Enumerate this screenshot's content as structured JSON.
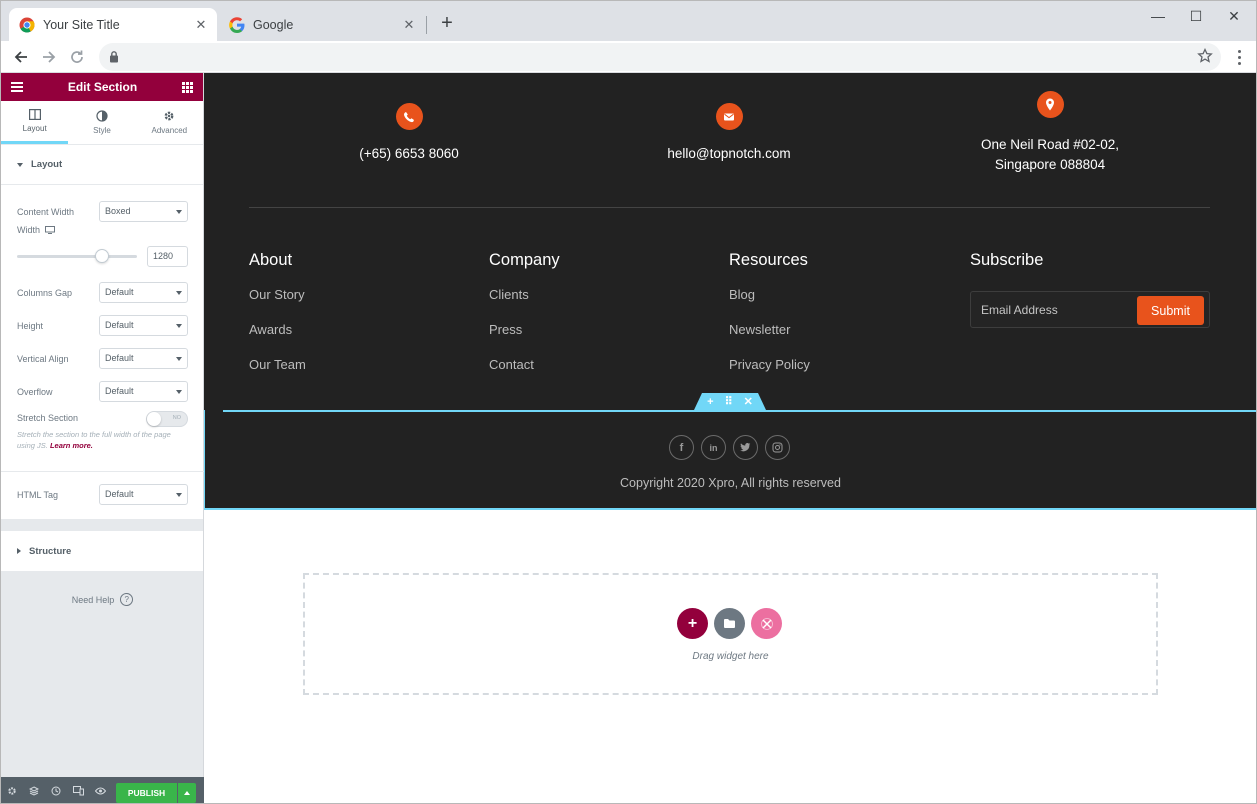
{
  "browser": {
    "tabs": [
      {
        "title": "Your Site Title",
        "icon": "chrome-icon",
        "active": true
      },
      {
        "title": "Google",
        "icon": "google-icon",
        "active": false
      }
    ],
    "new_tab_label": "+",
    "close_glyph": "✕",
    "window_controls": {
      "minimize": "—",
      "maximize": "☐",
      "close": "✕"
    }
  },
  "editor": {
    "header_title": "Edit Section",
    "tabs": [
      {
        "label": "Layout",
        "icon": "columns-icon",
        "active": true
      },
      {
        "label": "Style",
        "icon": "contrast-icon",
        "active": false
      },
      {
        "label": "Advanced",
        "icon": "gear-icon",
        "active": false
      }
    ],
    "layout_section": {
      "title": "Layout",
      "content_width": {
        "label": "Content Width",
        "value": "Boxed"
      },
      "width": {
        "label": "Width",
        "value": "1280"
      },
      "columns_gap": {
        "label": "Columns Gap",
        "value": "Default"
      },
      "height": {
        "label": "Height",
        "value": "Default"
      },
      "vertical_align": {
        "label": "Vertical Align",
        "value": "Default"
      },
      "overflow": {
        "label": "Overflow",
        "value": "Default"
      },
      "stretch_section": {
        "label": "Stretch Section",
        "toggle_text": "NO",
        "enabled": false
      },
      "stretch_desc": "Stretch the section to the full width of the page using JS.",
      "learn_more": "Learn more.",
      "html_tag": {
        "label": "HTML Tag",
        "value": "Default"
      }
    },
    "structure_title": "Structure",
    "need_help": "Need Help",
    "help_glyph": "?",
    "publish_label": "PUBLISH"
  },
  "site": {
    "contacts": [
      {
        "icon": "phone-icon",
        "lines": [
          "(+65) 6653 8060"
        ]
      },
      {
        "icon": "envelope-icon",
        "lines": [
          "hello@topnotch.com"
        ]
      },
      {
        "icon": "location-icon",
        "lines": [
          "One Neil Road #02-02,",
          "Singapore 088804"
        ]
      }
    ],
    "columns": [
      {
        "title": "About",
        "links": [
          "Our Story",
          "Awards",
          "Our Team"
        ]
      },
      {
        "title": "Company",
        "links": [
          "Clients",
          "Press",
          "Contact"
        ]
      },
      {
        "title": "Resources",
        "links": [
          "Blog",
          "Newsletter",
          "Privacy Policy"
        ]
      }
    ],
    "subscribe": {
      "title": "Subscribe",
      "placeholder": "Email Address",
      "button": "Submit"
    },
    "section_handle": {
      "add": "+",
      "move": "⠿",
      "delete": "✕"
    },
    "social": [
      {
        "name": "facebook",
        "glyph": "f"
      },
      {
        "name": "linkedin",
        "glyph": "in"
      },
      {
        "name": "twitter",
        "glyph": "t"
      },
      {
        "name": "instagram",
        "glyph": "◎"
      }
    ],
    "copyright": "Copyright 2020 Xpro, All rights reserved",
    "dropzone_text": "Drag widget here"
  },
  "colors": {
    "brand": "#93003c",
    "accent_orange": "#e8531c",
    "selection_blue": "#71d7f7",
    "publish_green": "#39b54a",
    "footer_bg": "#222222"
  }
}
